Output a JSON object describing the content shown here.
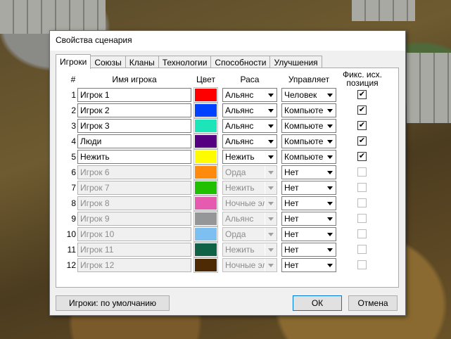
{
  "dialog": {
    "title": "Свойства сценария",
    "tabs": [
      {
        "label": "Игроки",
        "active": true
      },
      {
        "label": "Союзы",
        "active": false
      },
      {
        "label": "Кланы",
        "active": false
      },
      {
        "label": "Технологии",
        "active": false
      },
      {
        "label": "Способности",
        "active": false
      },
      {
        "label": "Улучшения",
        "active": false
      }
    ],
    "columns": {
      "num": "#",
      "name": "Имя игрока",
      "color": "Цвет",
      "race": "Раса",
      "controller": "Управляет",
      "fixed_line1": "Фикс. исх.",
      "fixed_line2": "позиция"
    },
    "players": [
      {
        "num": "1",
        "name": "Игрок 1",
        "color": "#ff0000",
        "race": "Альянс",
        "controller": "Человек",
        "fixed": true,
        "enabled": true
      },
      {
        "num": "2",
        "name": "Игрок 2",
        "color": "#0042ff",
        "race": "Альянс",
        "controller": "Компьютер",
        "fixed": true,
        "enabled": true
      },
      {
        "num": "3",
        "name": "Игрок 3",
        "color": "#1ce6b9",
        "race": "Альянс",
        "controller": "Компьютер",
        "fixed": true,
        "enabled": true
      },
      {
        "num": "4",
        "name": "Люди",
        "color": "#540081",
        "race": "Альянс",
        "controller": "Компьютер",
        "fixed": true,
        "enabled": true
      },
      {
        "num": "5",
        "name": "Нежить",
        "color": "#fffc00",
        "race": "Нежить",
        "controller": "Компьютер",
        "fixed": true,
        "enabled": true
      },
      {
        "num": "6",
        "name": "Игрок 6",
        "color": "#fe8a0e",
        "race": "Орда",
        "controller": "Нет",
        "fixed": false,
        "enabled": false
      },
      {
        "num": "7",
        "name": "Игрок 7",
        "color": "#20c000",
        "race": "Нежить",
        "controller": "Нет",
        "fixed": false,
        "enabled": false
      },
      {
        "num": "8",
        "name": "Игрок 8",
        "color": "#e55bb0",
        "race": "Ночные эльфы",
        "controller": "Нет",
        "fixed": false,
        "enabled": false
      },
      {
        "num": "9",
        "name": "Игрок 9",
        "color": "#959697",
        "race": "Альянс",
        "controller": "Нет",
        "fixed": false,
        "enabled": false
      },
      {
        "num": "10",
        "name": "Игрок 10",
        "color": "#7ebff1",
        "race": "Орда",
        "controller": "Нет",
        "fixed": false,
        "enabled": false
      },
      {
        "num": "11",
        "name": "Игрок 11",
        "color": "#106246",
        "race": "Нежить",
        "controller": "Нет",
        "fixed": false,
        "enabled": false
      },
      {
        "num": "12",
        "name": "Игрок 12",
        "color": "#4e2a04",
        "race": "Ночные эльфы",
        "controller": "Нет",
        "fixed": false,
        "enabled": false
      }
    ],
    "buttons": {
      "defaults": "Игроки: по умолчанию",
      "ok": "ОК",
      "cancel": "Отмена"
    },
    "checkmark": "✔"
  }
}
